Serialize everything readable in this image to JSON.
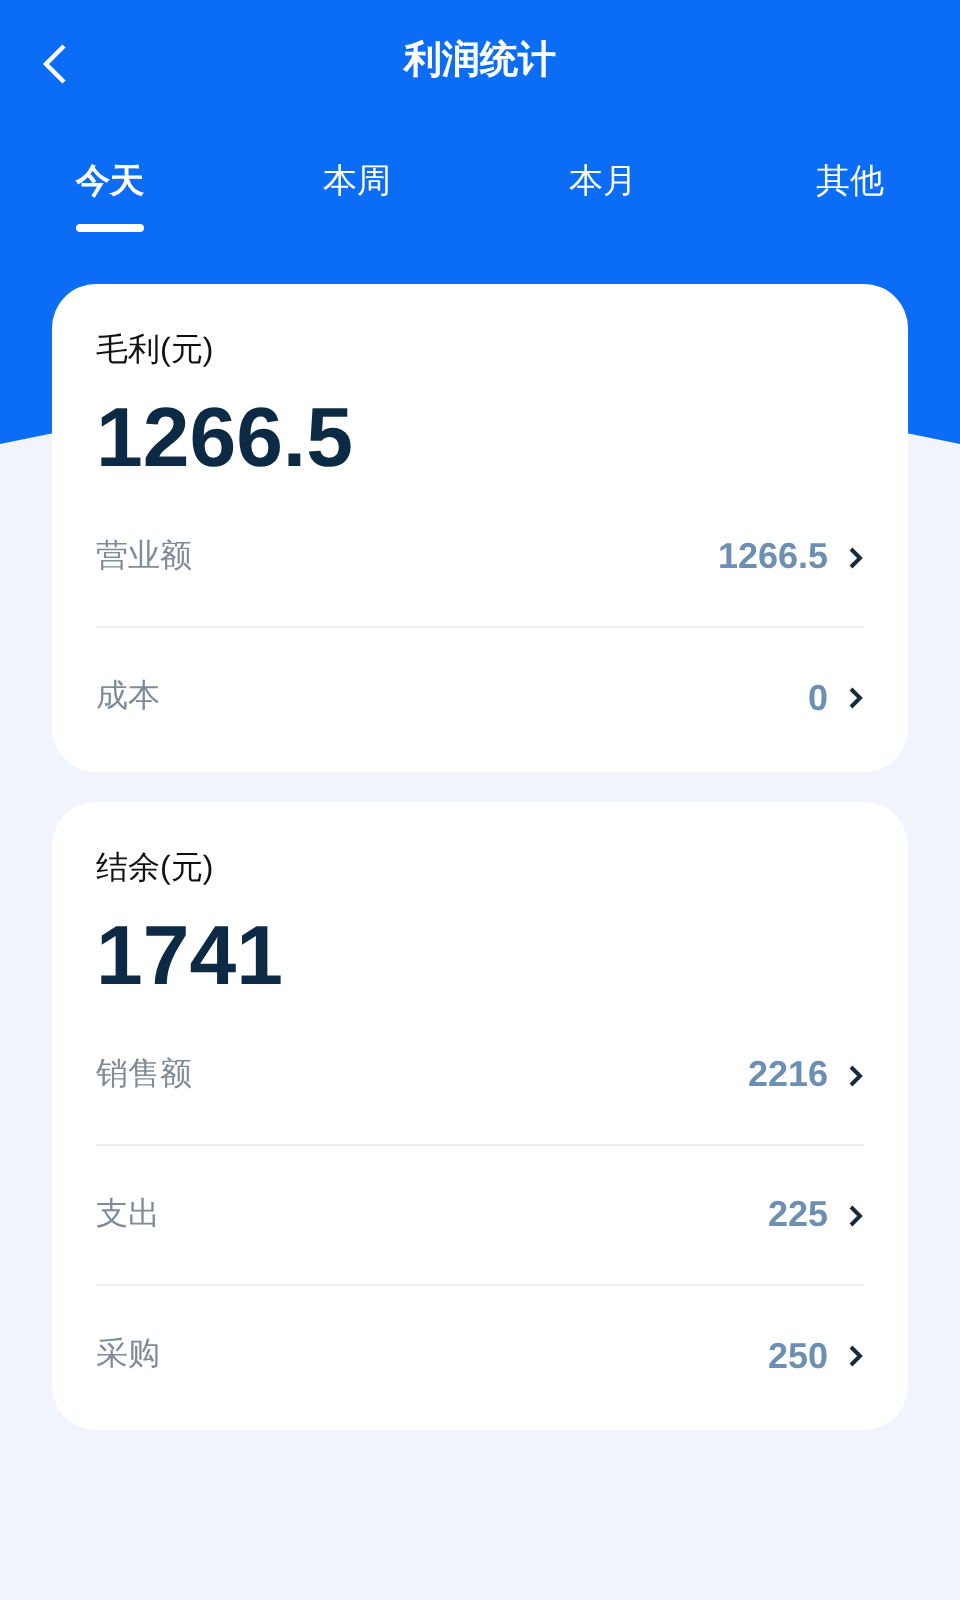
{
  "header": {
    "title": "利润统计"
  },
  "tabs": [
    {
      "label": "今天",
      "selected": true
    },
    {
      "label": "本周",
      "selected": false
    },
    {
      "label": "本月",
      "selected": false
    },
    {
      "label": "其他",
      "selected": false
    }
  ],
  "cards": [
    {
      "title": "毛利(元)",
      "amount": "1266.5",
      "rows": [
        {
          "label": "营业额",
          "value": "1266.5"
        },
        {
          "label": "成本",
          "value": "0"
        }
      ]
    },
    {
      "title": "结余(元)",
      "amount": "1741",
      "rows": [
        {
          "label": "销售额",
          "value": "2216"
        },
        {
          "label": "支出",
          "value": "225"
        },
        {
          "label": "采购",
          "value": "250"
        }
      ]
    }
  ]
}
